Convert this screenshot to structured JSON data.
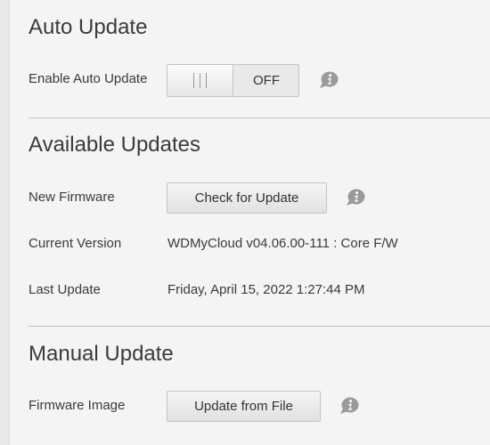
{
  "auto_update": {
    "title": "Auto Update",
    "enable_label": "Enable Auto Update",
    "toggle_state": "OFF",
    "info_icon": "info-bubble-icon"
  },
  "available_updates": {
    "title": "Available Updates",
    "new_firmware_label": "New Firmware",
    "check_button_label": "Check for Update",
    "current_version_label": "Current Version",
    "current_version_value": "WDMyCloud v04.06.00-111 : Core F/W",
    "last_update_label": "Last Update",
    "last_update_value": "Friday, April 15, 2022 1:27:44 PM",
    "info_icon": "info-bubble-icon"
  },
  "manual_update": {
    "title": "Manual Update",
    "firmware_image_label": "Firmware Image",
    "update_button_label": "Update from File",
    "info_icon": "info-bubble-icon"
  },
  "colors": {
    "background": "#f4f4f4",
    "text": "#333333",
    "divider": "#bfbfbf",
    "button_border": "#c4c4c4",
    "info_icon": "#9a9a9a"
  }
}
